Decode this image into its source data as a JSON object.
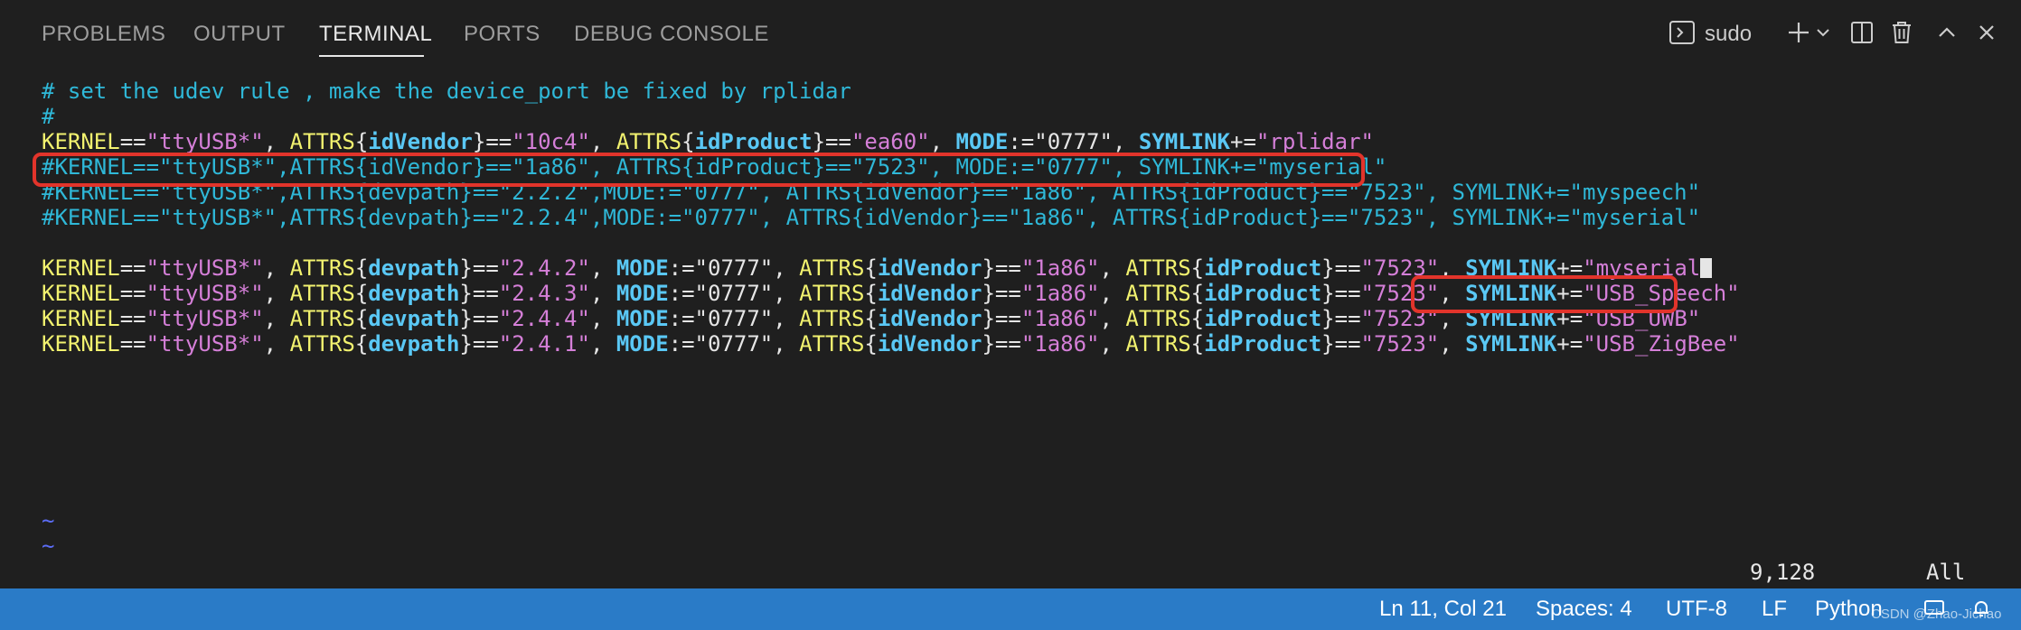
{
  "panel": {
    "tabs": [
      {
        "label": "PROBLEMS",
        "active": false
      },
      {
        "label": "OUTPUT",
        "active": false
      },
      {
        "label": "TERMINAL",
        "active": true
      },
      {
        "label": "PORTS",
        "active": false
      },
      {
        "label": "DEBUG CONSOLE",
        "active": false
      }
    ],
    "terminal_name": "sudo",
    "icons": [
      "terminal-icon",
      "plus-icon",
      "chevron-down-icon",
      "split-icon",
      "trash-icon",
      "chevron-up-icon",
      "close-icon"
    ]
  },
  "editor": {
    "lines": {
      "l1": "# set the udev rule , make the device_port be fixed by rplidar",
      "l2": "#",
      "l3": [
        {
          "t": "KERNEL",
          "c": "k-yellow"
        },
        {
          "t": "==",
          "c": "plain"
        },
        {
          "t": "\"ttyUSB*\"",
          "c": "str"
        },
        {
          "t": ", ",
          "c": "plain"
        },
        {
          "t": "ATTRS",
          "c": "k-yellow"
        },
        {
          "t": "{",
          "c": "brace"
        },
        {
          "t": "idVendor",
          "c": "k-blue"
        },
        {
          "t": "}",
          "c": "brace"
        },
        {
          "t": "==",
          "c": "plain"
        },
        {
          "t": "\"10c4\"",
          "c": "str"
        },
        {
          "t": ", ",
          "c": "plain"
        },
        {
          "t": "ATTRS",
          "c": "k-yellow"
        },
        {
          "t": "{",
          "c": "brace"
        },
        {
          "t": "idProduct",
          "c": "k-blue"
        },
        {
          "t": "}",
          "c": "brace"
        },
        {
          "t": "==",
          "c": "plain"
        },
        {
          "t": "\"ea60\"",
          "c": "str"
        },
        {
          "t": ", ",
          "c": "plain"
        },
        {
          "t": "MODE",
          "c": "k-blue"
        },
        {
          "t": ":=",
          "c": "plain"
        },
        {
          "t": "\"0777\"",
          "c": "plain"
        },
        {
          "t": ", ",
          "c": "plain"
        },
        {
          "t": "SYMLINK",
          "c": "k-blue"
        },
        {
          "t": "+=",
          "c": "plain"
        },
        {
          "t": "\"rplidar\"",
          "c": "str"
        }
      ],
      "l4": "#KERNEL==\"ttyUSB*\",ATTRS{idVendor}==\"1a86\", ATTRS{idProduct}==\"7523\", MODE:=\"0777\", SYMLINK+=\"myserial\"",
      "l5": "#KERNEL==\"ttyUSB*\",ATTRS{devpath}==\"2.2.2\",MODE:=\"0777\", ATTRS{idVendor}==\"1a86\", ATTRS{idProduct}==\"7523\", SYMLINK+=\"myspeech\"",
      "l6": "#KERNEL==\"ttyUSB*\",ATTRS{devpath}==\"2.2.4\",MODE:=\"0777\", ATTRS{idVendor}==\"1a86\", ATTRS{idProduct}==\"7523\", SYMLINK+=\"myserial\"",
      "rules": [
        {
          "devpath": "\"2.4.2\"",
          "symlink": "\"myserial"
        },
        {
          "devpath": "\"2.4.3\"",
          "symlink": "\"USB_Speech\""
        },
        {
          "devpath": "\"2.4.4\"",
          "symlink": "\"USB_UWB\""
        },
        {
          "devpath": "\"2.4.1\"",
          "symlink": "\"USB_ZigBee\""
        }
      ],
      "cursor_tail": "\"",
      "tilde": "~"
    },
    "rule_parts": {
      "kernel": "KERNEL",
      "eq": "==",
      "tty": "\"ttyUSB*\"",
      "sep": ", ",
      "attrs": "ATTRS",
      "lb": "{",
      "rb": "}",
      "devpath": "devpath",
      "mode": "MODE",
      "assign": ":=",
      "mode_val": "\"0777\"",
      "idvendor": "idVendor",
      "vendor_val": "\"1a86\"",
      "idproduct": "idProduct",
      "product_val": "\"7523\"",
      "symlink": "SYMLINK",
      "append": "+="
    },
    "vim_position": "9,128",
    "vim_scroll": "All"
  },
  "statusbar": {
    "cursor": "Ln 11, Col 21",
    "spaces": "Spaces: 4",
    "encoding": "UTF-8",
    "eol": "LF",
    "language": "Python",
    "watermark": "CSDN @Zhao-Jichao"
  },
  "colors": {
    "background": "#1f1f1f",
    "statusbar": "#2a7bc7",
    "highlight_box": "#e2342b"
  }
}
